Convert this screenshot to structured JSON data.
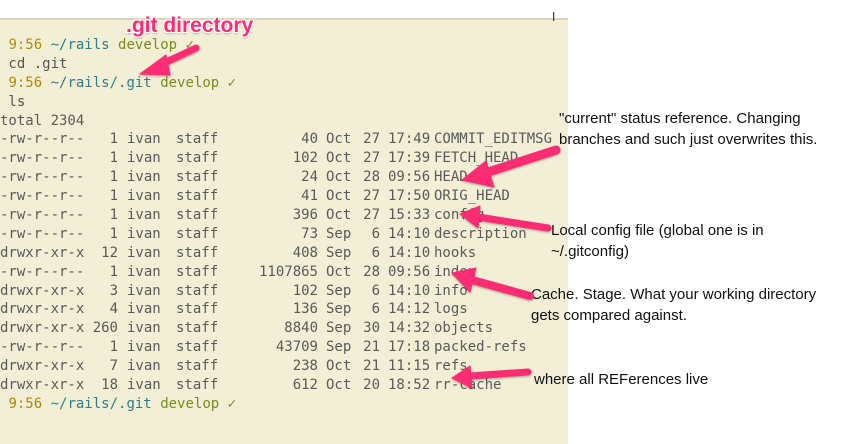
{
  "callout_title": ".git directory",
  "corner_mark": "ⅼ",
  "terminal": {
    "lines": [
      {
        "type": "prompt",
        "time": "9:56",
        "path": "~/rails",
        "branch": "develop",
        "check": "✓"
      },
      {
        "type": "cmd",
        "text": " cd .git"
      },
      {
        "type": "prompt",
        "time": "9:56",
        "path": "~/rails/.git",
        "branch": "develop",
        "check": "✓"
      },
      {
        "type": "cmd",
        "text": " ls"
      },
      {
        "type": "plain",
        "text": "total 2304"
      }
    ],
    "listing": [
      {
        "perm": "-rw-r--r--",
        "links": "1",
        "user": "ivan",
        "group": "staff",
        "size": "40",
        "month": "Oct",
        "day": "27",
        "time": "17:49",
        "name": "COMMIT_EDITMSG"
      },
      {
        "perm": "-rw-r--r--",
        "links": "1",
        "user": "ivan",
        "group": "staff",
        "size": "102",
        "month": "Oct",
        "day": "27",
        "time": "17:39",
        "name": "FETCH_HEAD"
      },
      {
        "perm": "-rw-r--r--",
        "links": "1",
        "user": "ivan",
        "group": "staff",
        "size": "24",
        "month": "Oct",
        "day": "28",
        "time": "09:56",
        "name": "HEAD"
      },
      {
        "perm": "-rw-r--r--",
        "links": "1",
        "user": "ivan",
        "group": "staff",
        "size": "41",
        "month": "Oct",
        "day": "27",
        "time": "17:50",
        "name": "ORIG_HEAD"
      },
      {
        "perm": "-rw-r--r--",
        "links": "1",
        "user": "ivan",
        "group": "staff",
        "size": "396",
        "month": "Oct",
        "day": "27",
        "time": "15:33",
        "name": "config"
      },
      {
        "perm": "-rw-r--r--",
        "links": "1",
        "user": "ivan",
        "group": "staff",
        "size": "73",
        "month": "Sep",
        "day": "6",
        "time": "14:10",
        "name": "description"
      },
      {
        "perm": "drwxr-xr-x",
        "links": "12",
        "user": "ivan",
        "group": "staff",
        "size": "408",
        "month": "Sep",
        "day": "6",
        "time": "14:10",
        "name": "hooks"
      },
      {
        "perm": "-rw-r--r--",
        "links": "1",
        "user": "ivan",
        "group": "staff",
        "size": "1107865",
        "month": "Oct",
        "day": "28",
        "time": "09:56",
        "name": "index"
      },
      {
        "perm": "drwxr-xr-x",
        "links": "3",
        "user": "ivan",
        "group": "staff",
        "size": "102",
        "month": "Sep",
        "day": "6",
        "time": "14:10",
        "name": "info"
      },
      {
        "perm": "drwxr-xr-x",
        "links": "4",
        "user": "ivan",
        "group": "staff",
        "size": "136",
        "month": "Sep",
        "day": "6",
        "time": "14:12",
        "name": "logs"
      },
      {
        "perm": "drwxr-xr-x",
        "links": "260",
        "user": "ivan",
        "group": "staff",
        "size": "8840",
        "month": "Sep",
        "day": "30",
        "time": "14:32",
        "name": "objects"
      },
      {
        "perm": "-rw-r--r--",
        "links": "1",
        "user": "ivan",
        "group": "staff",
        "size": "43709",
        "month": "Sep",
        "day": "21",
        "time": "17:18",
        "name": "packed-refs"
      },
      {
        "perm": "drwxr-xr-x",
        "links": "7",
        "user": "ivan",
        "group": "staff",
        "size": "238",
        "month": "Oct",
        "day": "21",
        "time": "11:15",
        "name": "refs"
      },
      {
        "perm": "drwxr-xr-x",
        "links": "18",
        "user": "ivan",
        "group": "staff",
        "size": "612",
        "month": "Oct",
        "day": "20",
        "time": "18:52",
        "name": "rr-cache"
      }
    ],
    "final_prompt": {
      "time": "9:56",
      "path": "~/rails/.git",
      "branch": "develop",
      "check": "✓"
    }
  },
  "notes": {
    "current": "\"current\" status reference. Changing branches and such just overwrites this.",
    "config": "Local config file (global one is in ~/.gitconfig)",
    "cache": "Cache. Stage. What your working directory gets compared against.",
    "refs": "where all REFerences live"
  },
  "colors": {
    "terminal_bg": "#f2efd6",
    "arrow": "#ff2b73",
    "prompt_time": "#b08a00",
    "prompt_path": "#2e7f86",
    "prompt_branch": "#7a8b1c"
  }
}
